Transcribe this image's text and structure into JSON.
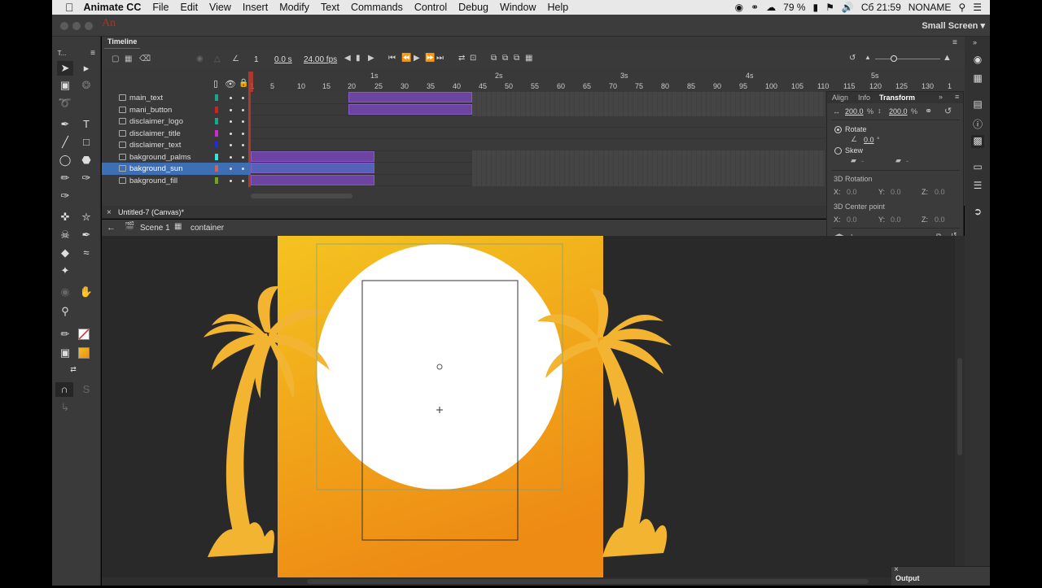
{
  "menubar": {
    "app_name": "Animate CC",
    "items": [
      "File",
      "Edit",
      "View",
      "Insert",
      "Modify",
      "Text",
      "Commands",
      "Control",
      "Debug",
      "Window",
      "Help"
    ],
    "battery": "79 %",
    "clock": "Сб 21:59",
    "user": "NONAME"
  },
  "titlebar": {
    "logo": "An",
    "workspace": "Small Screen"
  },
  "timeline": {
    "tab": "Timeline",
    "frame": "1",
    "time": "0.0 s",
    "fps": "24.00 fps",
    "ruler_seconds": [
      "1s",
      "2s",
      "3s",
      "4s",
      "5s"
    ],
    "ruler_frames": [
      "1",
      "5",
      "10",
      "15",
      "20",
      "25",
      "30",
      "35",
      "40",
      "45",
      "50",
      "55",
      "60",
      "65",
      "70",
      "75",
      "80",
      "85",
      "90",
      "95",
      "100",
      "105",
      "110",
      "115",
      "120",
      "125",
      "130",
      "1"
    ],
    "layers": [
      {
        "name": "main_text",
        "color": "#1fa38a"
      },
      {
        "name": "mani_button",
        "color": "#d21f1f"
      },
      {
        "name": "disclaimer_logo",
        "color": "#1fa38a"
      },
      {
        "name": "disclaimer_title",
        "color": "#d226d2"
      },
      {
        "name": "disclaimer_text",
        "color": "#1f2fd2"
      },
      {
        "name": "bakground_palms",
        "color": "#2fe6e6"
      },
      {
        "name": "bakground_sun",
        "color": "#d26060"
      },
      {
        "name": "bakground_fill",
        "color": "#6ea61f"
      }
    ]
  },
  "transform": {
    "tabs": [
      "Align",
      "Info",
      "Transform"
    ],
    "width_pct": "200.0",
    "height_pct": "200.0",
    "pct": "%",
    "rotate_label": "Rotate",
    "rotate_val": "0.0",
    "skew_label": "Skew",
    "skew_val": "-",
    "rot3d_label": "3D Rotation",
    "center3d_label": "3D Center point",
    "x": "X:",
    "y": "Y:",
    "z": "Z:",
    "rot_x": "0.0",
    "rot_y": "0.0",
    "rot_z": "0.0",
    "cp_x": "0.0",
    "cp_y": "0.0",
    "cp_z": "0.0",
    "deg": "°"
  },
  "document": {
    "tab": "Untitled-7 (Canvas)*",
    "scene": "Scene 1",
    "symbol": "container"
  },
  "output": {
    "label": "Output"
  },
  "colors": {
    "accent": "#3e6fb5",
    "span": "#6c45a3",
    "sun": "#ffffff",
    "bg_top": "#f3c21f",
    "bg_bottom": "#ee8c12",
    "palm": "#f3b432"
  }
}
